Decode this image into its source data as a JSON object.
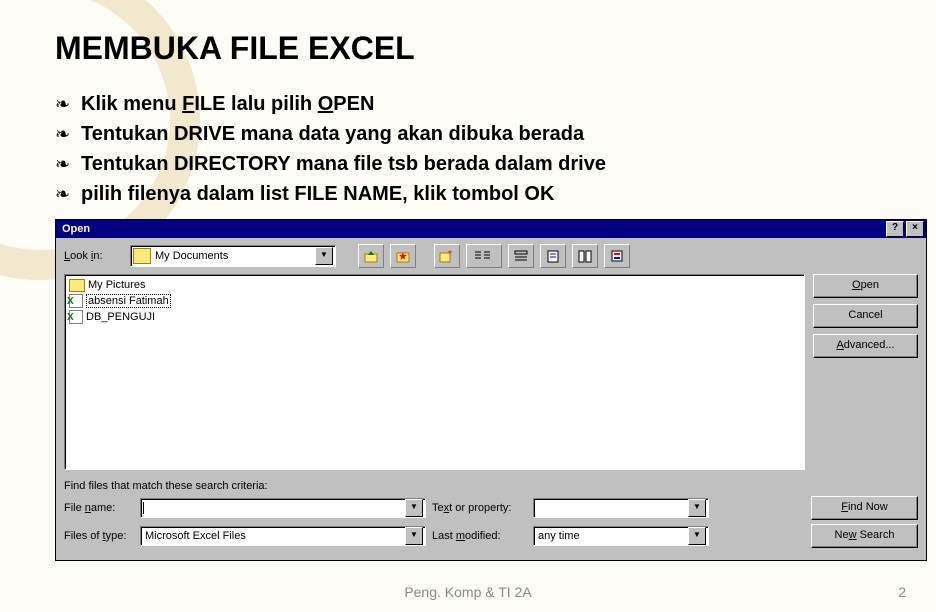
{
  "slide": {
    "title": "MEMBUKA FILE EXCEL",
    "bullets": [
      {
        "pre": "Klik menu ",
        "u1": "F",
        "mid": "ILE lalu pilih ",
        "u2": "O",
        "post": "PEN"
      },
      {
        "text": "Tentukan DRIVE mana data yang akan dibuka berada"
      },
      {
        "text": "Tentukan DIRECTORY mana file tsb berada dalam drive"
      },
      {
        "text": "pilih filenya dalam list FILE NAME, klik tombol OK"
      }
    ],
    "footer": "Peng. Komp & TI 2A",
    "page": "2"
  },
  "dialog": {
    "title": "Open",
    "help_btn": "?",
    "close_btn": "×",
    "lookin_label": "Look in:",
    "lookin_value": "My Documents",
    "dropdown_arrow": "▼",
    "files": [
      {
        "type": "folder",
        "name": "My Pictures",
        "selected": false
      },
      {
        "type": "xls",
        "name": "absensi Fatimah",
        "selected": true
      },
      {
        "type": "xls",
        "name": "DB_PENGUJI",
        "selected": false
      }
    ],
    "buttons": {
      "open": "Open",
      "cancel": "Cancel",
      "advanced": "Advanced..."
    },
    "search": {
      "title": "Find files that match these search criteria:",
      "filename_label": "File name:",
      "filename_value": "",
      "text_label": "Text or property:",
      "text_value": "",
      "filetype_label": "Files of type:",
      "filetype_value": "Microsoft Excel Files",
      "lastmod_label": "Last modified:",
      "lastmod_value": "any time",
      "findnow": "Find Now",
      "newsearch": "New Search"
    }
  }
}
